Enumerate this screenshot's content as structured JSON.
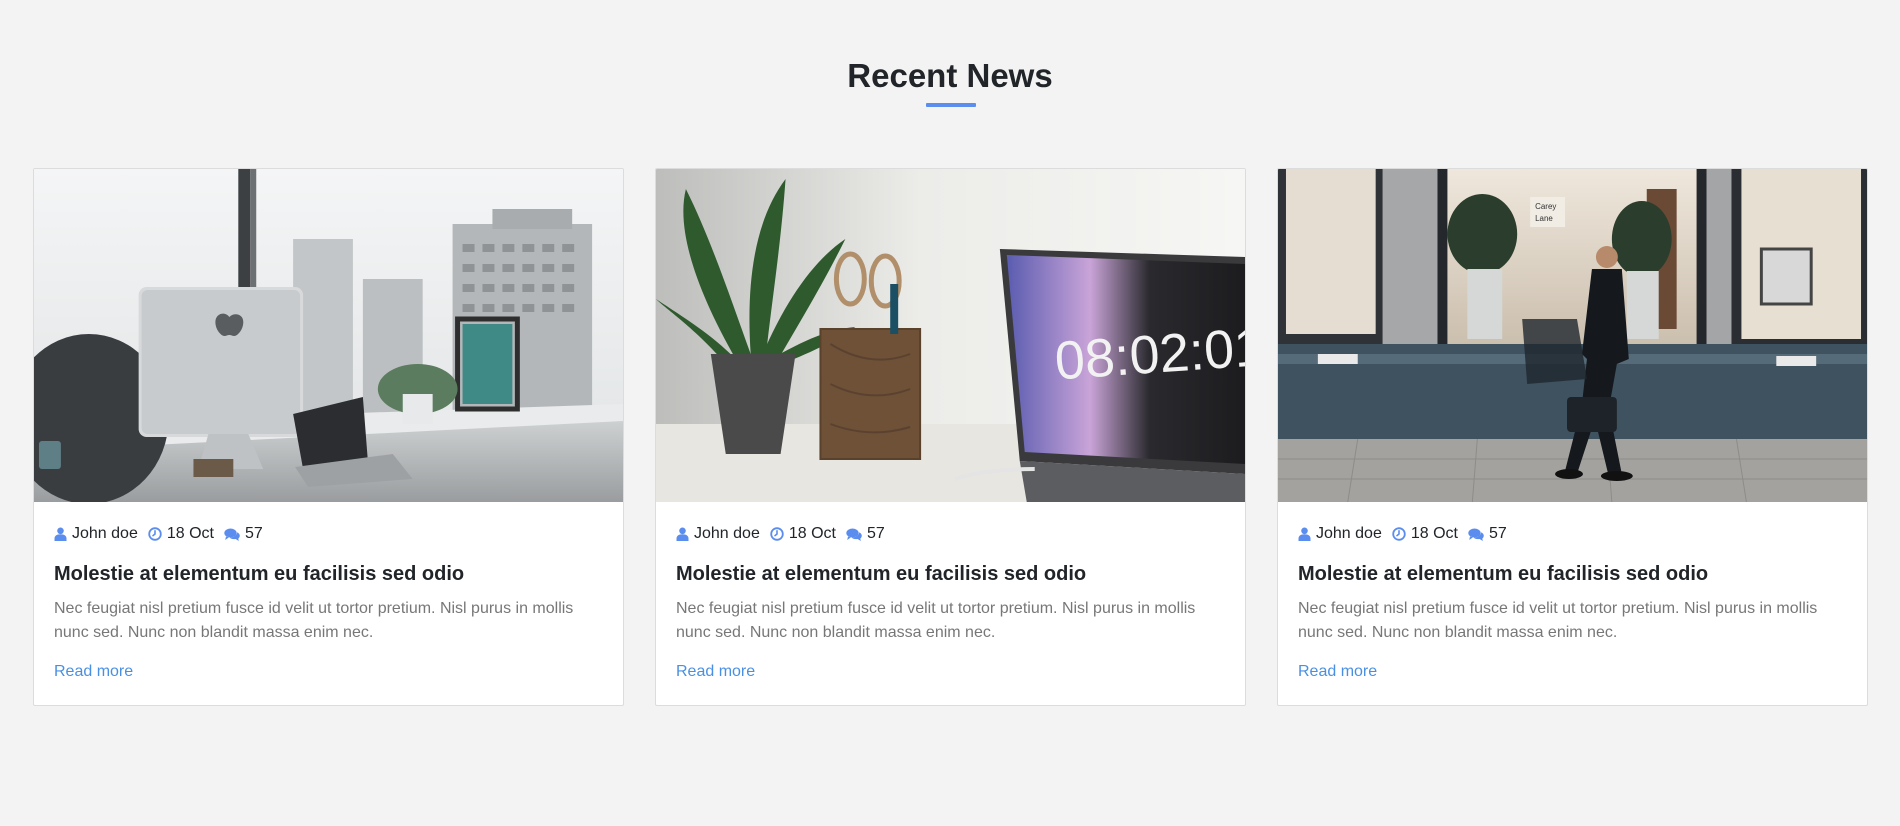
{
  "section": {
    "title": "Recent News",
    "accent_color": "#5b8def"
  },
  "cards": [
    {
      "image": "office-desk-imac-photo",
      "author": "John doe",
      "date": "18 Oct",
      "comments": "57",
      "title": "Molestie at elementum eu facilisis sed odio",
      "excerpt": "Nec feugiat nisl pretium fusce id velit ut tortor pretium. Nisl purus in mollis nunc sed. Nunc non blandit massa enim nec.",
      "link": "Read more"
    },
    {
      "image": "laptop-clock-plant-photo",
      "author": "John doe",
      "date": "18 Oct",
      "comments": "57",
      "title": "Molestie at elementum eu facilisis sed odio",
      "excerpt": "Nec feugiat nisl pretium fusce id velit ut tortor pretium. Nisl purus in mollis nunc sed. Nunc non blandit massa enim nec.",
      "link": "Read more",
      "clock_text": "08:02:01"
    },
    {
      "image": "businessman-walking-street-photo",
      "author": "John doe",
      "date": "18 Oct",
      "comments": "57",
      "title": "Molestie at elementum eu facilisis sed odio",
      "excerpt": "Nec feugiat nisl pretium fusce id velit ut tortor pretium. Nisl purus in mollis nunc sed. Nunc non blandit massa enim nec.",
      "link": "Read more"
    }
  ],
  "icons": {
    "author": "user-icon",
    "date": "clock-icon",
    "comments": "comments-icon"
  }
}
